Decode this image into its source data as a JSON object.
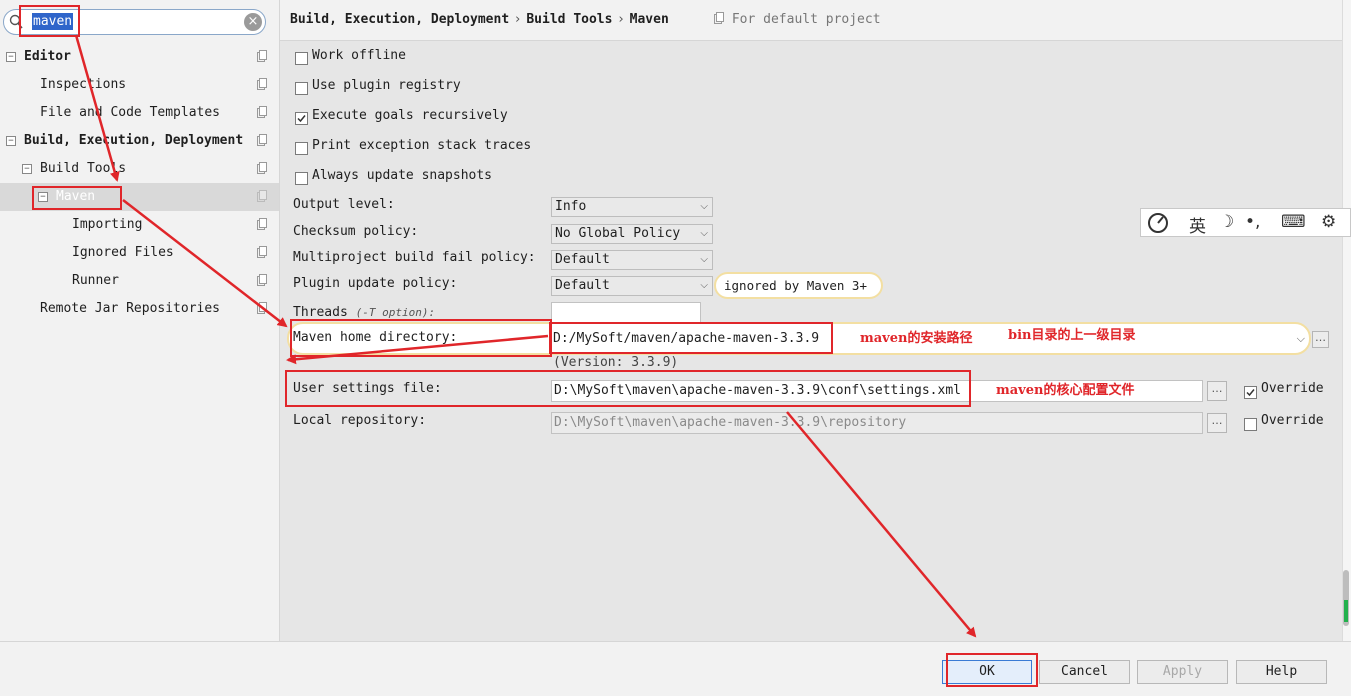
{
  "search": {
    "value": "maven"
  },
  "tree": {
    "editor": "Editor",
    "inspections": "Inspections",
    "file_templates": "File and Code Templates",
    "build_exec_deploy": "Build, Execution, Deployment",
    "build_tools": "Build Tools",
    "maven": "Maven",
    "importing": "Importing",
    "ignored_files": "Ignored Files",
    "runner": "Runner",
    "remote_jar": "Remote Jar Repositories"
  },
  "breadcrumb": {
    "part1": "Build, Execution, Deployment",
    "part2": "Build Tools",
    "part3": "Maven",
    "separator": "›",
    "for_default": "For default project"
  },
  "options": {
    "work_offline": {
      "label": "Work offline",
      "checked": false
    },
    "use_plugin_registry": {
      "label": "Use plugin registry",
      "checked": false
    },
    "execute_goals": {
      "label": "Execute goals recursively",
      "checked": true
    },
    "print_exception": {
      "label": "Print exception stack traces",
      "checked": false
    },
    "always_update": {
      "label": "Always update snapshots",
      "checked": false
    }
  },
  "settings": {
    "output_level": {
      "label": "Output level:",
      "value": "Info"
    },
    "checksum_policy": {
      "label": "Checksum policy:",
      "value": "No Global Policy"
    },
    "multiproject_fail": {
      "label": "Multiproject build fail policy:",
      "value": "Default"
    },
    "plugin_update": {
      "label": "Plugin update policy:",
      "value": "Default",
      "note": "ignored by Maven 3+"
    },
    "threads": {
      "label": "Threads",
      "hint": "(-T option):",
      "value": ""
    },
    "maven_home": {
      "label": "Maven home directory:",
      "value": "D:/MySoft/maven/apache-maven-3.3.9",
      "version": "(Version: 3.3.9)"
    },
    "user_settings": {
      "label": "User settings file:",
      "value": "D:\\MySoft\\maven\\apache-maven-3.3.9\\conf\\settings.xml",
      "override_label": "Override",
      "override_checked": true
    },
    "local_repo": {
      "label": "Local repository:",
      "value": "D:\\MySoft\\maven\\apache-maven-3.3.9\\repository",
      "override_label": "Override",
      "override_checked": false
    }
  },
  "annotations": {
    "install_path": "maven的安装路径",
    "bin_parent": "bin目录的上一级目录",
    "core_config": "maven的核心配置文件"
  },
  "ime": {
    "lang": "英",
    "moon": "☽",
    "punct": "•,",
    "keyboard": "⌨",
    "gear": "⚙"
  },
  "buttons": {
    "ok": "OK",
    "cancel": "Cancel",
    "apply": "Apply",
    "help": "Help"
  },
  "colors": {
    "annotation_red": "#e0262a",
    "selection_blue": "#2f65ca",
    "note_border": "#f3dfa2"
  },
  "icons": {
    "search": "search-icon",
    "clear": "clear-icon",
    "copy": "copy-icon",
    "dots": "browse-icon"
  }
}
